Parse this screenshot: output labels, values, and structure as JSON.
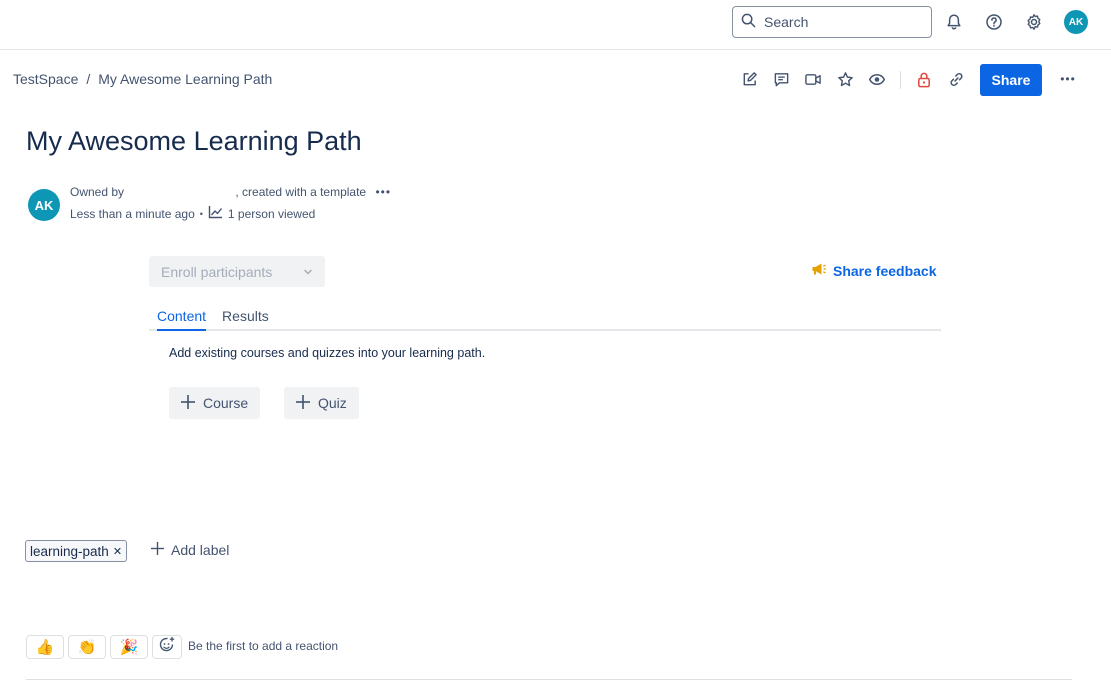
{
  "topbar": {
    "search_placeholder": "Search",
    "icons": [
      "bell-icon",
      "help-icon",
      "gear-icon"
    ],
    "avatar_initials": "AK"
  },
  "breadcrumb": {
    "space": "TestSpace",
    "separator": "/",
    "page": "My Awesome Learning Path"
  },
  "toolbar": {
    "icons": [
      "edit-icon",
      "comment-icon",
      "video-icon",
      "star-icon",
      "eye-icon",
      "lock-icon",
      "link-icon"
    ],
    "share_label": "Share",
    "more_label": "•••"
  },
  "page": {
    "title": "My Awesome Learning Path",
    "byline": {
      "avatar_initials": "AK",
      "owned_by_prefix": "Owned by",
      "created_suffix": ", created with a template",
      "more": "•••",
      "time": "Less than a minute ago",
      "dot": "•",
      "views": "1 person viewed"
    }
  },
  "learning_path": {
    "enroll_label": "Enroll participants",
    "feedback_label": "Share feedback",
    "tabs": [
      {
        "label": "Content",
        "active": true
      },
      {
        "label": "Results",
        "active": false
      }
    ],
    "description": "Add existing courses and quizzes into your learning path.",
    "add_course_label": "Course",
    "add_quiz_label": "Quiz"
  },
  "labels": {
    "items": [
      "learning-path"
    ],
    "remove_glyph": "✕",
    "add_label": "Add label"
  },
  "reactions": {
    "emojis": [
      "👍",
      "👏",
      "🎉"
    ],
    "prompt": "Be the first to add a reaction"
  },
  "colors": {
    "brand": "#0c66e4",
    "avatar": "#0e96b5",
    "lock": "#e2483d",
    "feedback_icon": "#e5a100"
  }
}
